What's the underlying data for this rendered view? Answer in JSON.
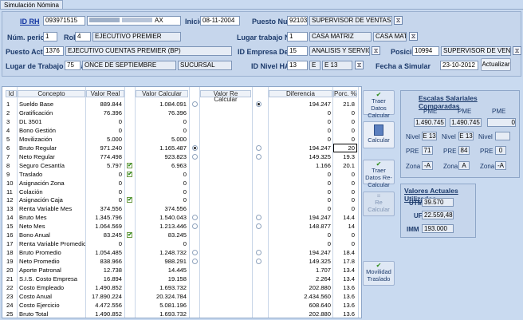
{
  "tab": "Simulación Nómina",
  "header": {
    "id_rh_label": "ID RH",
    "id_rh": "093971515",
    "name_suffix": "AX",
    "inicio_label": "Inicio",
    "inicio": "08-11-2004",
    "puesto_nuevo_label": "Puesto Nuevo",
    "puesto_nuevo_id": "92103",
    "puesto_nuevo": "SUPERVISOR DE VENTAS III",
    "num_periodo_label": "Núm. periodo",
    "num_periodo": "1",
    "rol_label": "Rol",
    "rol": "4",
    "rol_desc": "EJECUTIVO PREMIER",
    "lugar_nuevo_label": "Lugar trabajo Nuevo",
    "lugar_nuevo_id": "1",
    "lugar_nuevo": "CASA MATRIZ",
    "lugar_nuevo_2": "CASA MATRIZ",
    "puesto_actual_label": "Puesto Actual",
    "puesto_actual_id": "1376",
    "puesto_actual": "EJECUTIVO CUENTAS PREMIER (BP)",
    "empresa_label": "ID Empresa Destino",
    "empresa_id": "15",
    "empresa": "ANALISIS Y SERVICIOS S.A.",
    "posicion_label": "Posición",
    "posicion_id": "10994",
    "posicion": "SUPERVISOR DE VENTAS",
    "lugar_actual_label": "Lugar de Trabajo Actual",
    "lugar_actual_id": "75",
    "lugar_actual": "ONCE DE SEPTIEMBRE",
    "lugar_actual_2": "SUCURSAL",
    "nivel_label": "ID Nivel HAY",
    "nivel_id": "13",
    "nivel_e": "E",
    "nivel": "E 13",
    "fecha_label": "Fecha a Simular",
    "fecha": "23-10-2012",
    "actualizar": "Actualizar"
  },
  "grid": {
    "headers": {
      "id": "Id",
      "concepto": "Concepto",
      "valor_real": "Valor Real",
      "valor_calcular": "Valor Calcular",
      "valor_recalcular": "Valor Re Calcular",
      "diferencia": "Diferencia",
      "porc": "Porc. %"
    },
    "rows": [
      {
        "id": "1",
        "concepto": "Sueldo Base",
        "real": "889.844",
        "calc": "1.084.091",
        "dif": "194.247",
        "porc": "21.8"
      },
      {
        "id": "2",
        "concepto": "Gratificación",
        "real": "76.396",
        "calc": "76.396",
        "dif": "0",
        "porc": "0"
      },
      {
        "id": "3",
        "concepto": "DL 3501",
        "real": "0",
        "calc": "0",
        "dif": "0",
        "porc": "0"
      },
      {
        "id": "4",
        "concepto": "Bono Gestión",
        "real": "0",
        "calc": "0",
        "dif": "0",
        "porc": "0"
      },
      {
        "id": "5",
        "concepto": "Movilización",
        "real": "5.000",
        "calc": "5.000",
        "dif": "0",
        "porc": "0"
      },
      {
        "id": "6",
        "concepto": "Bruto Regular",
        "real": "971.240",
        "calc": "1.165.487",
        "dif": "194.247",
        "porc": "20"
      },
      {
        "id": "7",
        "concepto": "Neto Regular",
        "real": "774.498",
        "calc": "923.823",
        "dif": "149.325",
        "porc": "19.3"
      },
      {
        "id": "8",
        "concepto": "Seguro Cesantía",
        "real": "5.797",
        "calc": "6.963",
        "dif": "1.166",
        "porc": "20.1"
      },
      {
        "id": "9",
        "concepto": "Traslado",
        "real": "0",
        "calc": "0",
        "dif": "0",
        "porc": "0"
      },
      {
        "id": "10",
        "concepto": "Asignación Zona",
        "real": "0",
        "calc": "0",
        "dif": "0",
        "porc": "0"
      },
      {
        "id": "11",
        "concepto": "Colación",
        "real": "0",
        "calc": "0",
        "dif": "0",
        "porc": "0"
      },
      {
        "id": "12",
        "concepto": "Asignación Caja",
        "real": "0",
        "calc": "0",
        "dif": "0",
        "porc": "0"
      },
      {
        "id": "13",
        "concepto": "Renta Variable Mes",
        "real": "374.556",
        "calc": "374.556",
        "dif": "0",
        "porc": "0"
      },
      {
        "id": "14",
        "concepto": "Bruto Mes",
        "real": "1.345.796",
        "calc": "1.540.043",
        "dif": "194.247",
        "porc": "14.4"
      },
      {
        "id": "15",
        "concepto": "Neto Mes",
        "real": "1.064.569",
        "calc": "1.213.446",
        "dif": "148.877",
        "porc": "14"
      },
      {
        "id": "16",
        "concepto": "Bono Anual",
        "real": "83.245",
        "calc": "83.245",
        "dif": "0",
        "porc": "0"
      },
      {
        "id": "17",
        "concepto": "Renta Variable Promedio",
        "real": "0",
        "calc": "0",
        "dif": "0",
        "porc": "0"
      },
      {
        "id": "18",
        "concepto": "Bruto Promedio",
        "real": "1.054.485",
        "calc": "1.248.732",
        "dif": "194.247",
        "porc": "18.4"
      },
      {
        "id": "19",
        "concepto": "Neto Promedio",
        "real": "838.966",
        "calc": "988.291",
        "dif": "149.325",
        "porc": "17.8"
      },
      {
        "id": "20",
        "concepto": "Aporte Patronal",
        "real": "12.738",
        "calc": "14.445",
        "dif": "1.707",
        "porc": "13.4"
      },
      {
        "id": "21",
        "concepto": "S.I.S. Costo Empresa",
        "real": "16.894",
        "calc": "19.158",
        "dif": "2.264",
        "porc": "13.4"
      },
      {
        "id": "22",
        "concepto": "Costo Empleado",
        "real": "1.490.852",
        "calc": "1.693.732",
        "dif": "202.880",
        "porc": "13.6"
      },
      {
        "id": "23",
        "concepto": "Costo Anual",
        "real": "17.890.224",
        "calc": "20.324.784",
        "dif": "2.434.560",
        "porc": "13.6"
      },
      {
        "id": "24",
        "concepto": "Costo Ejercicio",
        "real": "4.472.556",
        "calc": "5.081.196",
        "dif": "608.640",
        "porc": "13.6"
      },
      {
        "id": "25",
        "concepto": "Bruto Total",
        "real": "1.490.852",
        "calc": "1.693.732",
        "dif": "202.880",
        "porc": "13.6"
      }
    ]
  },
  "side_buttons": {
    "traer_calc": "Traer Datos Calcular",
    "calcular": "Calcular",
    "traer_recalc": "Traer Datos Re-Calcular",
    "recalcular": "Re Calcular",
    "movilidad": "Movilidad Traslado"
  },
  "escalas": {
    "title": "Escalas Salariales Comparadas",
    "pme_label": "PME",
    "pme": [
      "1.490.745",
      "1.490.745",
      "0"
    ],
    "nivel_label": "Nivel",
    "nivel": [
      "E 13",
      "E 13",
      ""
    ],
    "pre_label": "PRE",
    "pre": [
      "71",
      "84",
      "0"
    ],
    "zona_label": "Zona",
    "zona": [
      "-A",
      "A",
      "-A"
    ]
  },
  "valores": {
    "title": "Valores Actuales Utilizados",
    "utm_label": "UTM",
    "utm": "39.570",
    "uf_label": "UF",
    "uf": "22.559,48",
    "imm_label": "IMM",
    "imm": "193.000"
  }
}
